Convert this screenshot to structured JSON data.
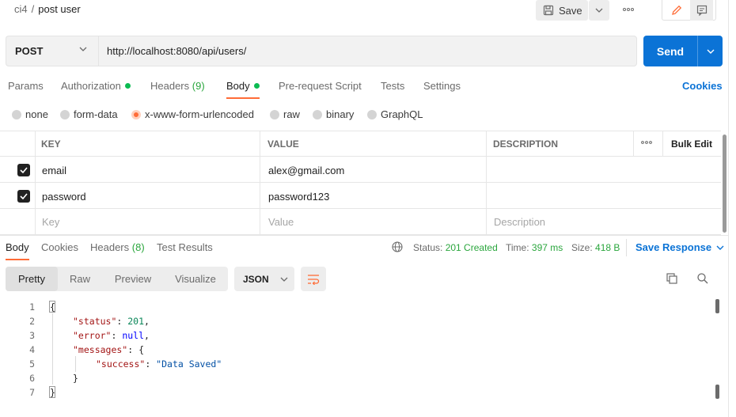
{
  "header": {
    "breadcrumb_parent": "ci4",
    "breadcrumb_sep": "/",
    "request_name": "post user",
    "save_label": "Save"
  },
  "request": {
    "method": "POST",
    "url": "http://localhost:8080/api/users/",
    "send_label": "Send"
  },
  "tabs": {
    "params": "Params",
    "authorization": "Authorization",
    "headers": "Headers",
    "headers_count": "(9)",
    "body": "Body",
    "prerequest": "Pre-request Script",
    "tests": "Tests",
    "settings": "Settings",
    "cookies": "Cookies"
  },
  "body_types": {
    "none": "none",
    "form_data": "form-data",
    "urlencoded": "x-www-form-urlencoded",
    "raw": "raw",
    "binary": "binary",
    "graphql": "GraphQL",
    "selected": "x-www-form-urlencoded"
  },
  "table": {
    "headers": {
      "key": "KEY",
      "value": "VALUE",
      "description": "DESCRIPTION",
      "bulk_edit": "Bulk Edit"
    },
    "rows": [
      {
        "key": "email",
        "value": "alex@gmail.com",
        "checked": true
      },
      {
        "key": "password",
        "value": "password123",
        "checked": true
      }
    ],
    "placeholders": {
      "key": "Key",
      "value": "Value",
      "description": "Description"
    }
  },
  "response": {
    "tabs": {
      "body": "Body",
      "cookies": "Cookies",
      "headers": "Headers",
      "headers_count": "(8)",
      "test_results": "Test Results"
    },
    "status_label": "Status:",
    "status_value": "201 Created",
    "time_label": "Time:",
    "time_value": "397 ms",
    "size_label": "Size:",
    "size_value": "418 B",
    "save_response": "Save Response",
    "views": {
      "pretty": "Pretty",
      "raw": "Raw",
      "preview": "Preview",
      "visualize": "Visualize"
    },
    "format": "JSON",
    "line_numbers": [
      "1",
      "2",
      "3",
      "4",
      "5",
      "6",
      "7"
    ],
    "code": {
      "open_brace": "{",
      "status_key": "\"status\"",
      "status_val": "201",
      "error_key": "\"error\"",
      "error_val": "null",
      "messages_key": "\"messages\"",
      "success_key": "\"success\"",
      "success_val": "\"Data Saved\"",
      "inner_close": "}",
      "close_brace": "}"
    }
  },
  "colors": {
    "accent": "#ff6c37",
    "send": "#0b73d6",
    "link": "#0b73d6",
    "success": "#0cbb52"
  }
}
